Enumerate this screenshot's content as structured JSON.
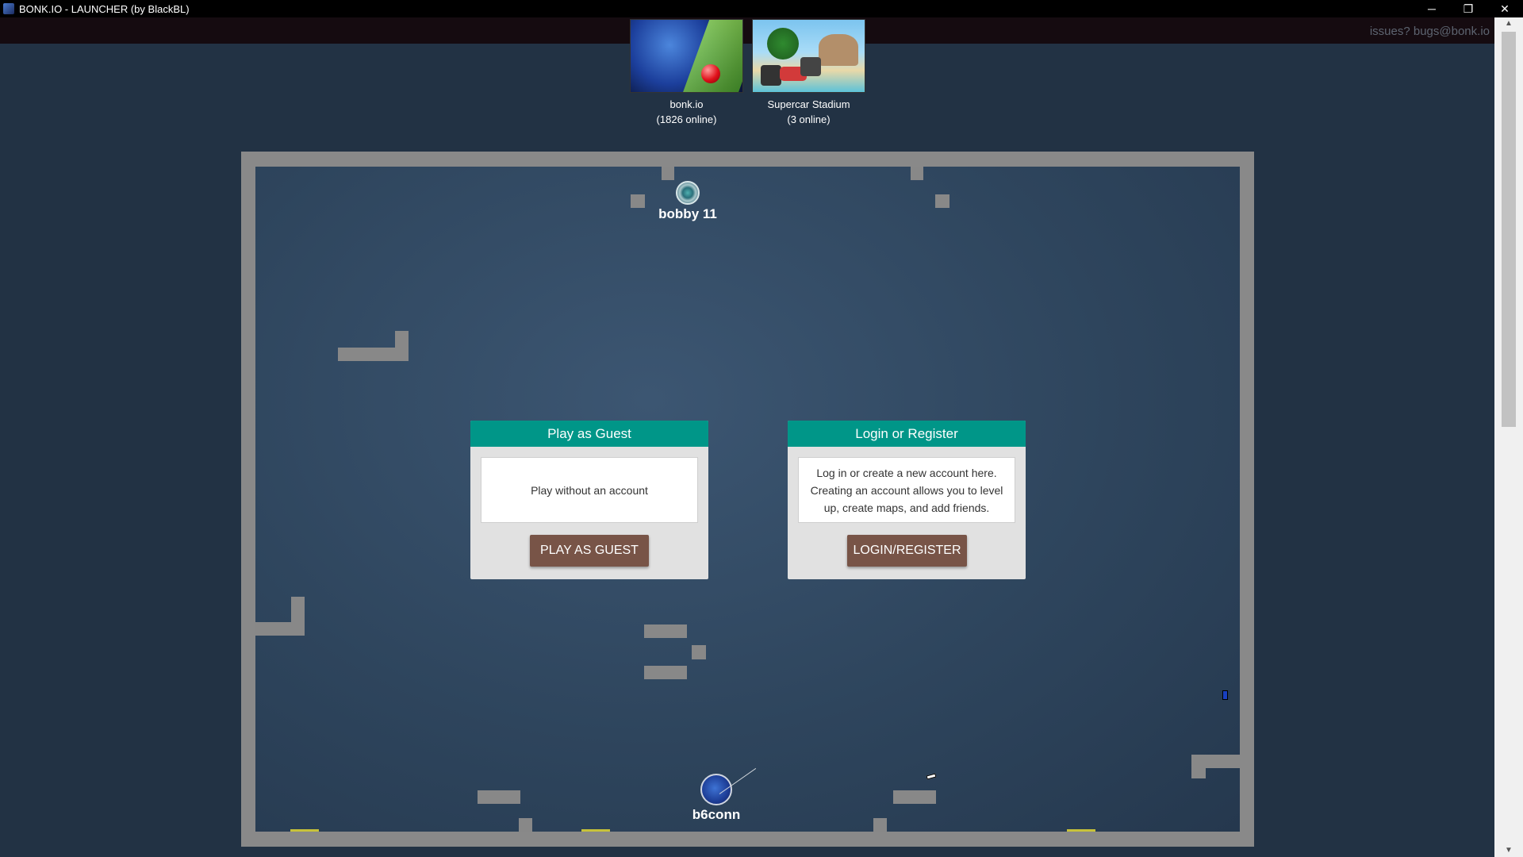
{
  "window": {
    "title": "BONK.IO - LAUNCHER (by BlackBL)",
    "controls": {
      "minimize": "─",
      "restore": "❐",
      "close": "✕"
    }
  },
  "header": {
    "issues_text": "issues? bugs@bonk.io"
  },
  "games": [
    {
      "name": "bonk.io",
      "online": "(1826 online)",
      "icon": "bonk-thumbnail"
    },
    {
      "name": "Supercar Stadium",
      "online": "(3 online)",
      "icon": "supercar-thumbnail"
    }
  ],
  "arena": {
    "players": [
      {
        "name": "bobby 11"
      },
      {
        "name": "b6conn"
      }
    ]
  },
  "guest_card": {
    "title": "Play as Guest",
    "description": "Play without an account",
    "button": "PLAY AS GUEST"
  },
  "login_card": {
    "title": "Login or Register",
    "description": "Log in or create a new account here. Creating an account allows you to level up, create maps, and add friends.",
    "button": "LOGIN/REGISTER"
  },
  "colors": {
    "card_header": "#009688",
    "button": "#785447",
    "background": "#223244",
    "wall": "#898989"
  }
}
